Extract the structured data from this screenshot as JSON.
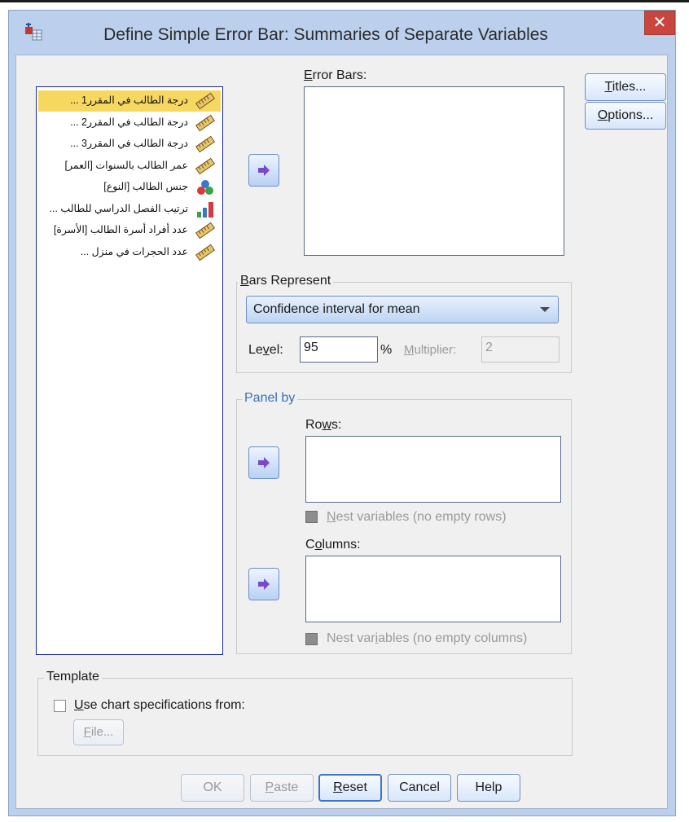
{
  "window": {
    "title": "Define Simple Error Bar: Summaries of Separate Variables",
    "close_label": "✕"
  },
  "variables": [
    {
      "label": "درجة الطالب في المقرر1 ...",
      "icon": "scale-ruler-icon",
      "selected": true
    },
    {
      "label": "درجة الطالب في المقرر2 ...",
      "icon": "scale-ruler-icon",
      "selected": false
    },
    {
      "label": "درجة الطالب في المقرر3 ...",
      "icon": "scale-ruler-icon",
      "selected": false
    },
    {
      "label": "عمر الطالب بالسنوات [العمر]",
      "icon": "scale-ruler-icon",
      "selected": false
    },
    {
      "label": "جنس الطالب [النوع]",
      "icon": "nominal-circles-icon",
      "selected": false
    },
    {
      "label": "ترتيب الفصل الدراسي للطالب ...",
      "icon": "ordinal-bars-icon",
      "selected": false
    },
    {
      "label": "عدد أفراد أسرة الطالب [الأسرة]",
      "icon": "scale-ruler-icon",
      "selected": false
    },
    {
      "label": "عدد الحجرات في منزل ...",
      "icon": "scale-ruler-icon",
      "selected": false
    }
  ],
  "error_bars": {
    "label_first": "E",
    "label_rest": "rror Bars:"
  },
  "bars_represent": {
    "title_first": "B",
    "title_rest": "ars Represent",
    "selected": "Confidence interval for mean",
    "level_pre": "Le",
    "level_u": "v",
    "level_post": "el:",
    "level_value": "95",
    "percent": "%",
    "multiplier_first": "M",
    "multiplier_rest": "ultiplier:",
    "multiplier_value": "2"
  },
  "panel_by": {
    "title": "Panel by",
    "rows_pre": "Ro",
    "rows_u": "w",
    "rows_post": "s:",
    "nest_rows_first": "N",
    "nest_rows_rest": "est variables (no empty rows)",
    "columns_pre": "C",
    "columns_u": "o",
    "columns_post": "lumns:",
    "nest_cols_pre": "Nest var",
    "nest_cols_u": "i",
    "nest_cols_post": "ables (no empty columns)"
  },
  "template": {
    "title": "Template",
    "use_first": "U",
    "use_rest": "se chart specifications from:",
    "file_first": "F",
    "file_rest": "ile..."
  },
  "side_buttons": {
    "titles_first": "T",
    "titles_rest": "itles...",
    "options_first": "O",
    "options_rest": "ptions..."
  },
  "bottom_buttons": {
    "ok": "OK",
    "paste_first": "P",
    "paste_rest": "aste",
    "reset_first": "R",
    "reset_rest": "eset",
    "cancel": "Cancel",
    "help": "Help"
  },
  "colors": {
    "title_bar": "#bcd0ee",
    "close": "#c9463f",
    "selection": "#f6d760",
    "list_border": "#1e2a8a"
  }
}
